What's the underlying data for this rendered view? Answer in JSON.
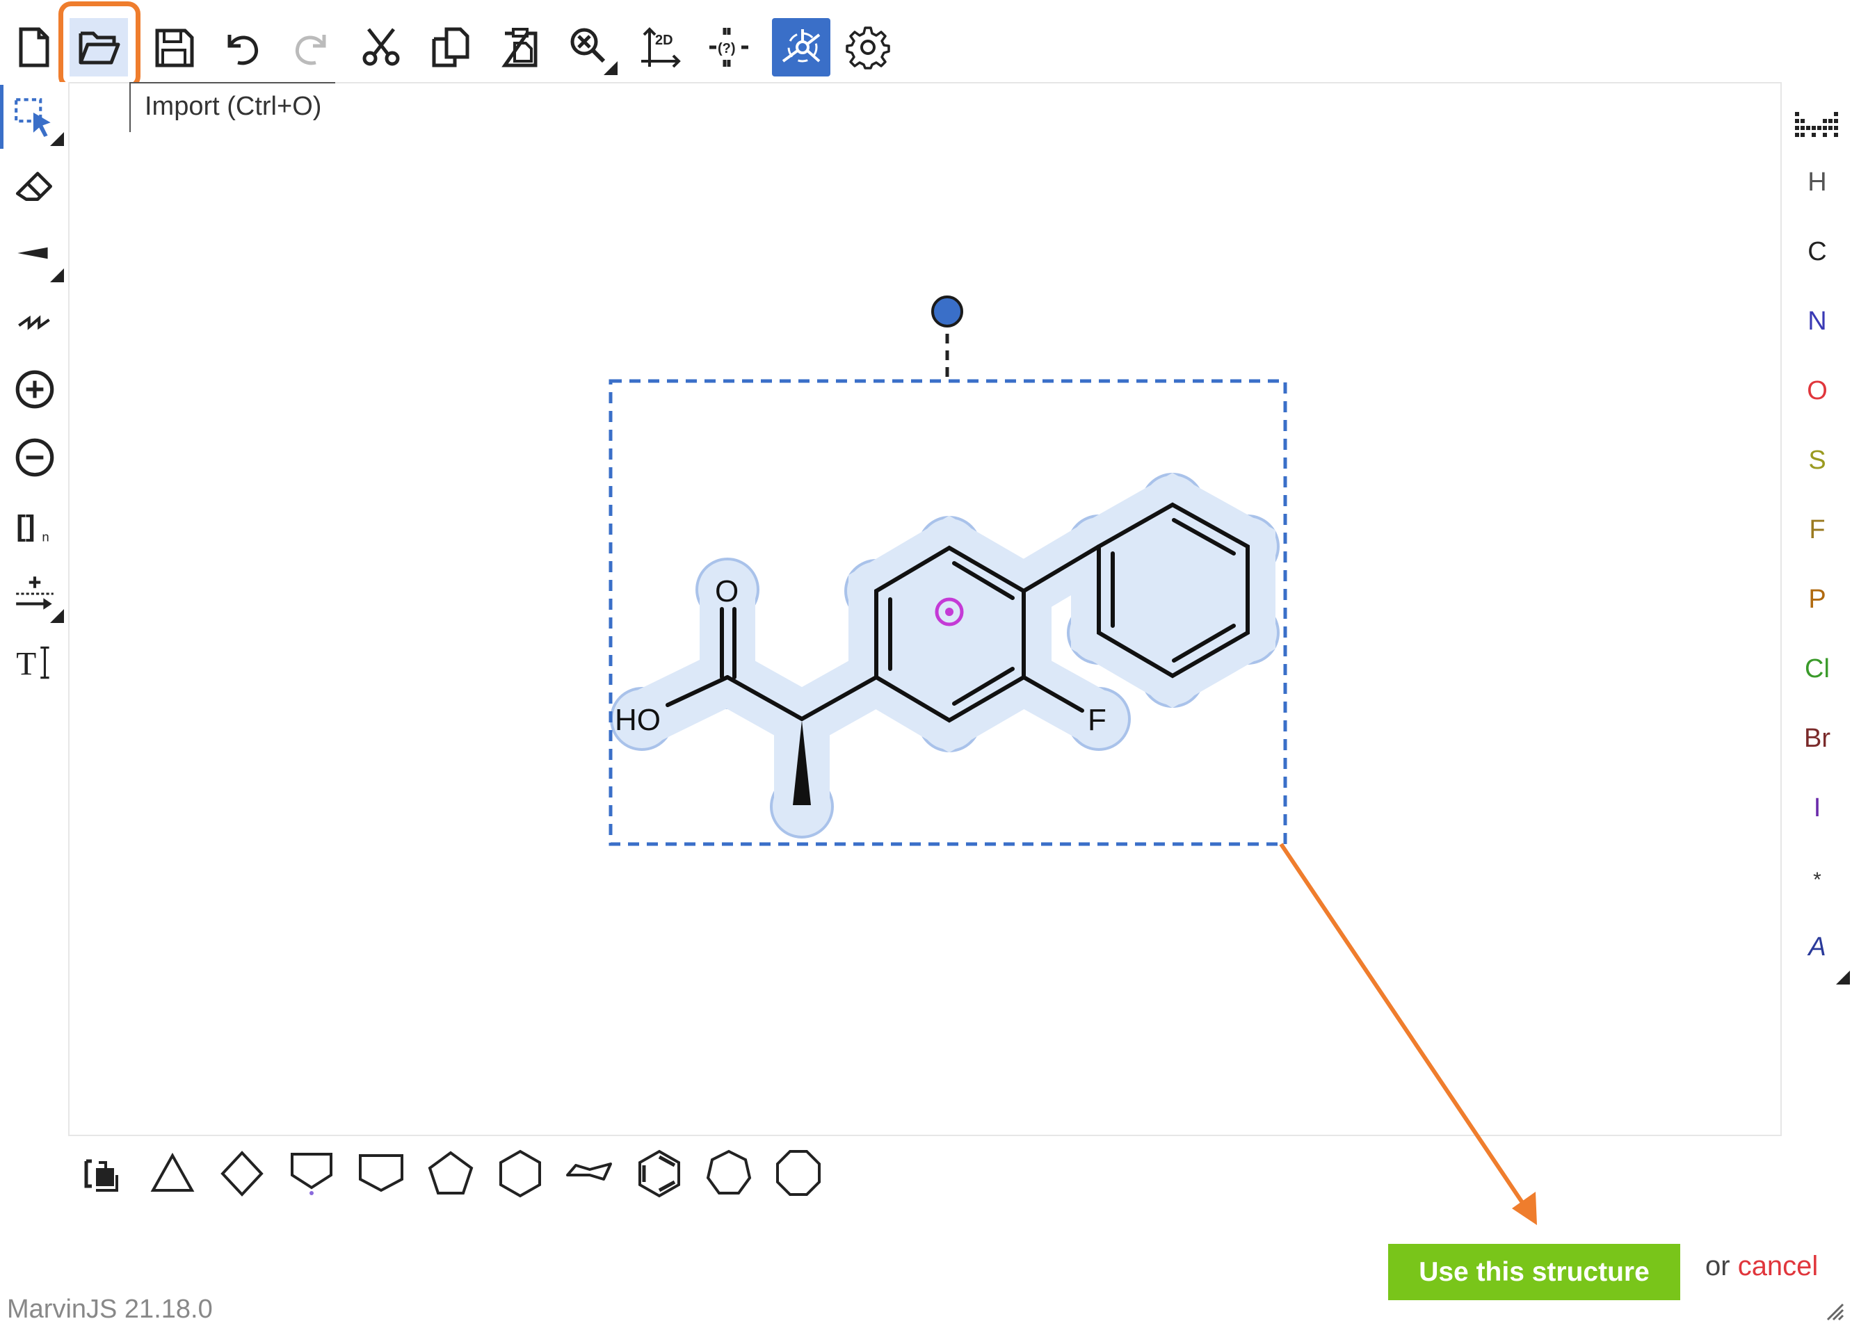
{
  "toolbar": {
    "items": [
      "new-document",
      "import",
      "save",
      "undo",
      "redo",
      "cut",
      "copy",
      "paste",
      "zoom",
      "clean-2d",
      "explicit-hydrogens",
      "marvin-services",
      "settings"
    ],
    "clean2d_label": "2D",
    "h_label": "(?)"
  },
  "tooltip": {
    "text": "Import (Ctrl+O)"
  },
  "left_tools": [
    "selection",
    "eraser",
    "bond",
    "chain",
    "increase-charge",
    "decrease-charge",
    "bracket",
    "reaction-arrow",
    "text"
  ],
  "bracket_label": "[]",
  "bracket_sub": "n",
  "text_tool_label": "T",
  "atoms": [
    {
      "symbol": "H",
      "color": "#555555"
    },
    {
      "symbol": "C",
      "color": "#222222"
    },
    {
      "symbol": "N",
      "color": "#3a3ab5"
    },
    {
      "symbol": "O",
      "color": "#e0363c"
    },
    {
      "symbol": "S",
      "color": "#9a9a20"
    },
    {
      "symbol": "F",
      "color": "#9a7a20"
    },
    {
      "symbol": "P",
      "color": "#b06a10"
    },
    {
      "symbol": "Cl",
      "color": "#3a9a2a"
    },
    {
      "symbol": "Br",
      "color": "#7a2a2a"
    },
    {
      "symbol": "I",
      "color": "#6a2aaa"
    },
    {
      "symbol": "*",
      "color": "#333333"
    },
    {
      "symbol": "A",
      "color": "#2a3a9a"
    }
  ],
  "molecule_labels": {
    "oxygen": "O",
    "hydroxyl": "HO",
    "fluorine": "F"
  },
  "templates": [
    "template-library",
    "cyclopropane",
    "cyclobutane",
    "cyclobutane-alt",
    "cyclopentane-alt",
    "cyclopentane",
    "cyclohexane",
    "cyclohexane-chair",
    "benzene",
    "cycloheptane",
    "cyclooctane"
  ],
  "footer": {
    "use_button": "Use this structure",
    "or_text": "or ",
    "cancel_text": "cancel",
    "version": "MarvinJS 21.18.0"
  },
  "colors": {
    "accent": "#3a6fc8",
    "highlight_orange": "#ef7d2d",
    "use_button_green": "#79c51a",
    "selection_halo": "#dce8f8"
  }
}
